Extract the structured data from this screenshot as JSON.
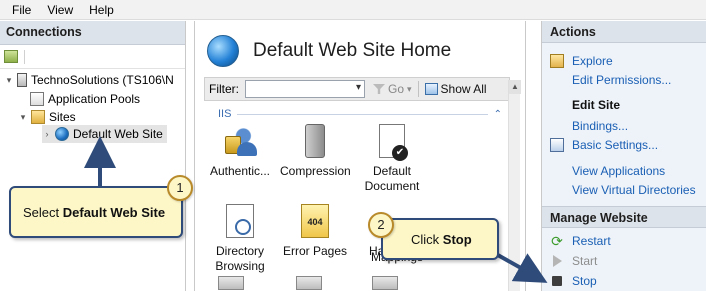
{
  "menu": {
    "items": [
      "File",
      "View",
      "Help"
    ]
  },
  "connections": {
    "title": "Connections",
    "tree": {
      "server": "TechnoSolutions (TS106\\N",
      "app_pools": "Application Pools",
      "sites": "Sites",
      "default_site": "Default Web Site"
    }
  },
  "center": {
    "title": "Default Web Site Home",
    "filter_label": "Filter:",
    "go_label": "Go",
    "show_all_label": "Show All",
    "group_label": "IIS",
    "features": [
      {
        "label": "Authentic...",
        "icon": "authentication-icon"
      },
      {
        "label": "Compression",
        "icon": "compression-icon"
      },
      {
        "label": "Default Document",
        "icon": "default-document-icon"
      },
      {
        "label": "Directory Browsing",
        "icon": "directory-browsing-icon"
      },
      {
        "label": "Error Pages",
        "icon": "error-pages-icon",
        "badge": "404"
      },
      {
        "label": "Handler Mappings",
        "icon": "handler-mappings-icon",
        "visible_text": "Ha"
      }
    ]
  },
  "actions": {
    "title": "Actions",
    "explore": "Explore",
    "edit_permissions": "Edit Permissions...",
    "edit_site": "Edit Site",
    "bindings": "Bindings...",
    "basic_settings": "Basic Settings...",
    "view_applications": "View Applications",
    "view_virtual_dirs": "View Virtual Directories",
    "manage_title": "Manage Website",
    "restart": "Restart",
    "start": "Start",
    "stop": "Stop"
  },
  "callouts": {
    "step1": {
      "number": "1",
      "prefix": "Select ",
      "bold": "Default Web Site"
    },
    "step2": {
      "number": "2",
      "prefix": "Click ",
      "bold": "Stop"
    }
  },
  "colors": {
    "link": "#1a5fb4",
    "callout_fill": "#fdf7c8",
    "callout_border": "#2f4b7a",
    "arrow": "#2f4b7a"
  }
}
